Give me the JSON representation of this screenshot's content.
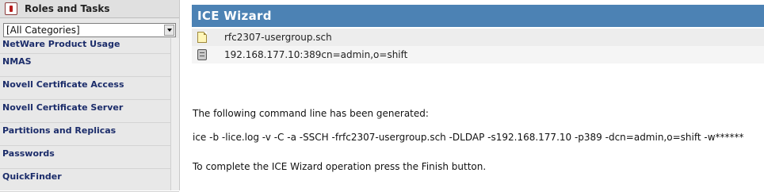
{
  "left_panel": {
    "title": "Roles and Tasks",
    "category_select": {
      "value": "[All Categories]"
    },
    "items": [
      "NetWare Product Usage",
      "NMAS",
      "Novell Certificate Access",
      "Novell Certificate Server",
      "Partitions and Replicas",
      "Passwords",
      "QuickFinder"
    ]
  },
  "wizard": {
    "title": "ICE Wizard",
    "source_file": "rfc2307-usergroup.sch",
    "destination": "192.168.177.10:389cn=admin,o=shift",
    "generated_label": "The following command line has been generated:",
    "command_line": "ice -b -lice.log -v -C -a -SSCH -frfc2307-usergroup.sch -DLDAP -s192.168.177.10 -p389 -dcn=admin,o=shift -w******",
    "finish_instructions": "To complete the ICE Wizard operation press the Finish button."
  },
  "colors": {
    "header_blue": "#4c82b4",
    "nav_text": "#1b2c6a",
    "panel_bg": "#e8e8e8"
  }
}
